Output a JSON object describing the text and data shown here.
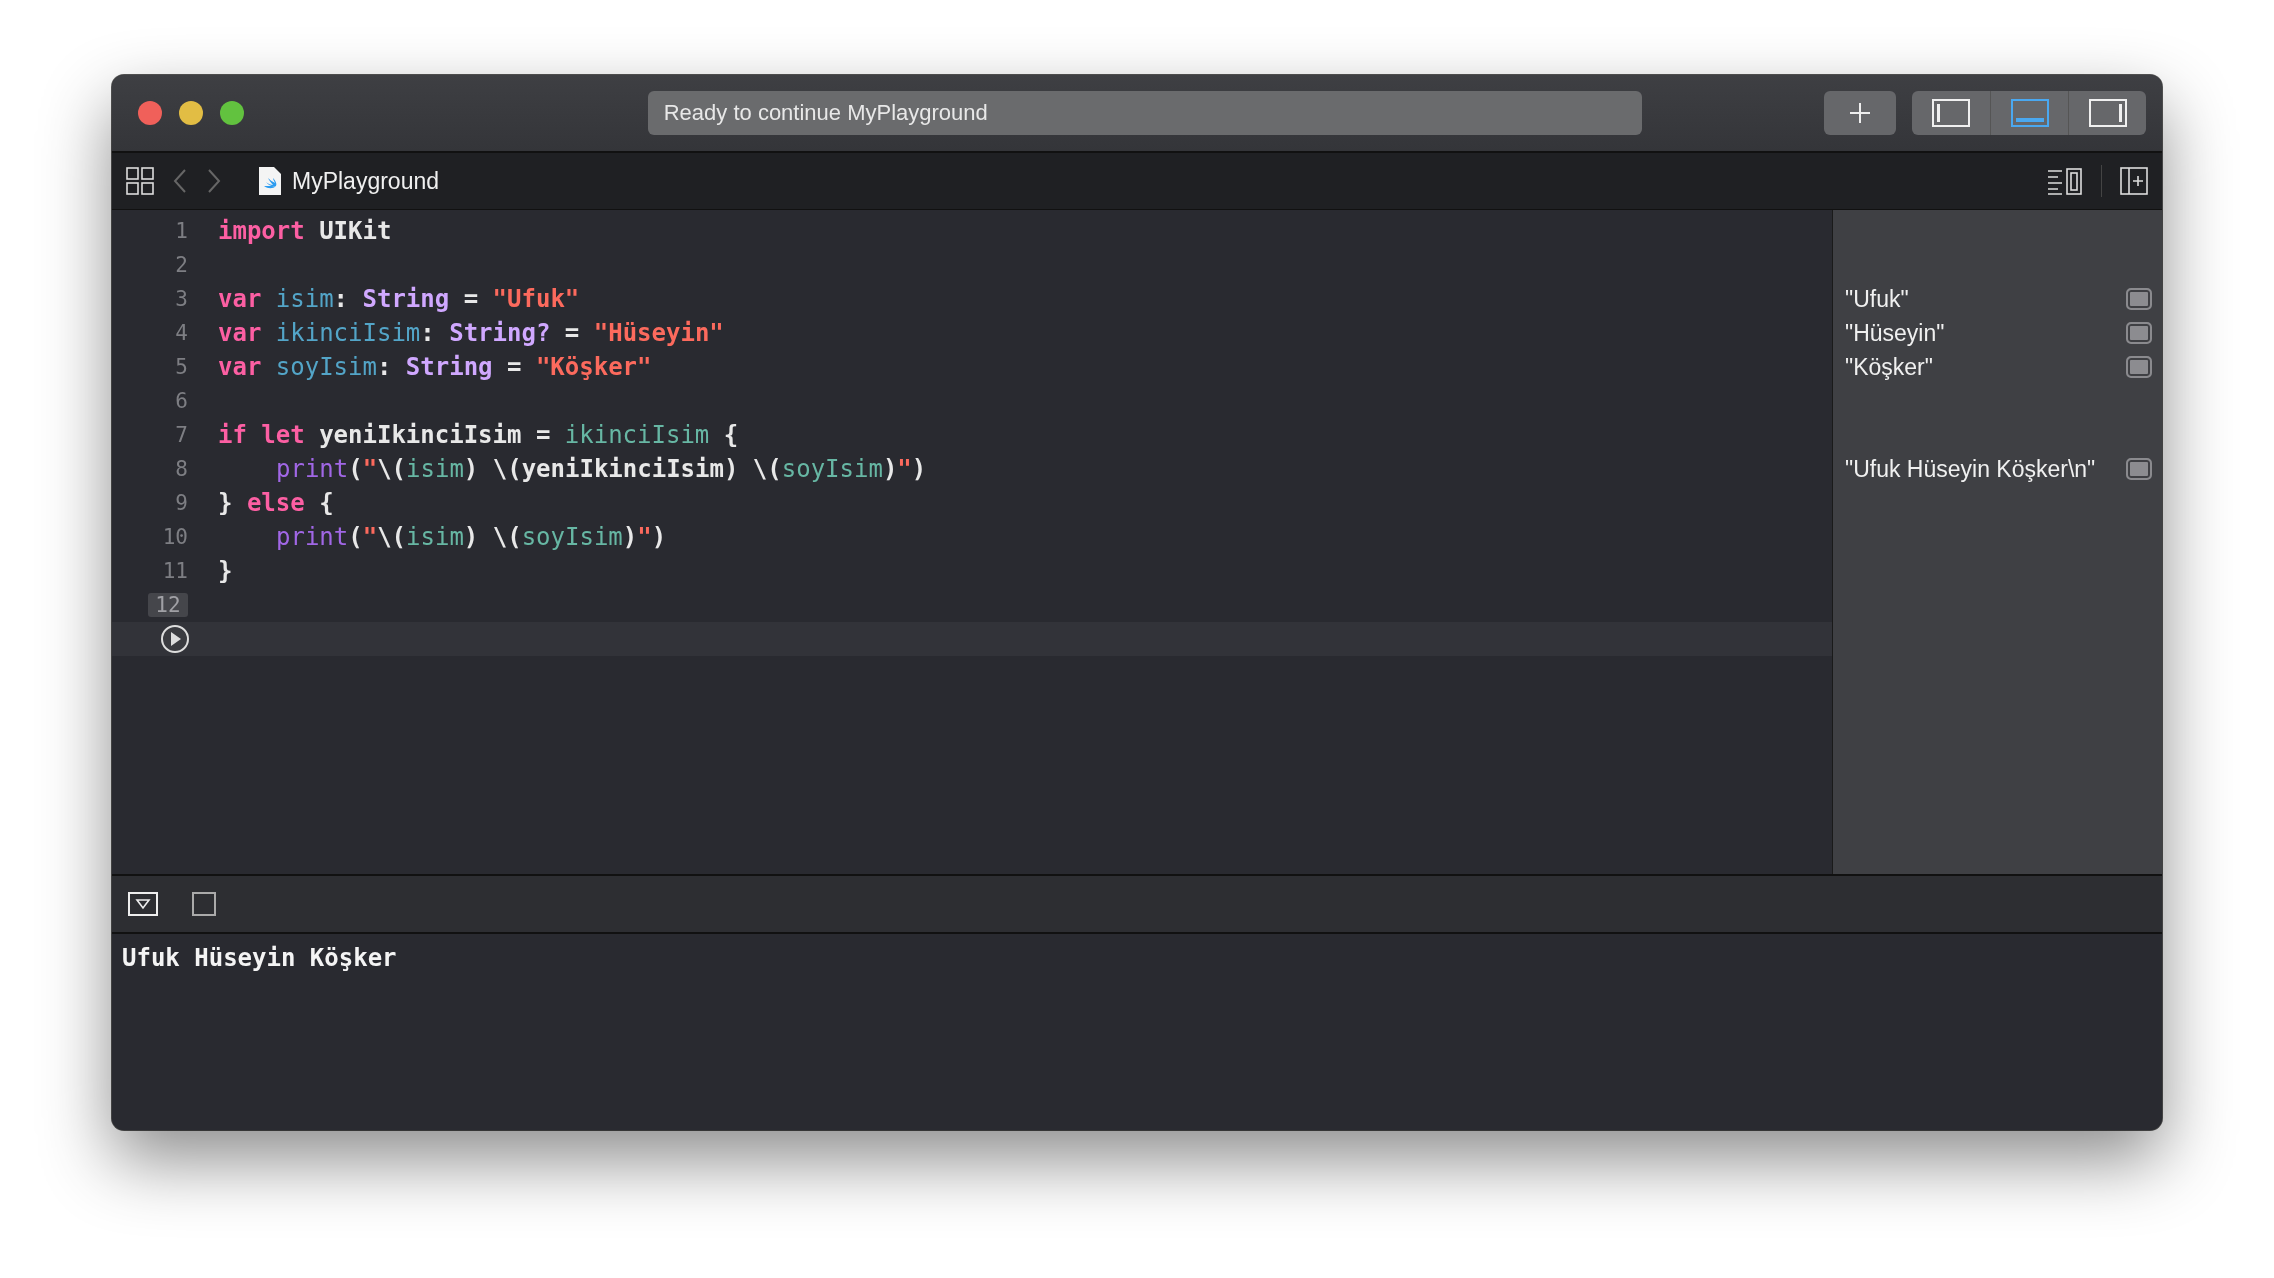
{
  "window": {
    "title": "Ready to continue MyPlayground",
    "layout_toggles": [
      {
        "kind": "left",
        "selected": false
      },
      {
        "kind": "bottom",
        "selected": true
      },
      {
        "kind": "right",
        "selected": false
      }
    ]
  },
  "jump_bar": {
    "file": "MyPlayground"
  },
  "editor": {
    "lines": [
      {
        "number": "1",
        "current": false,
        "tokens": [
          {
            "kind": "keyword",
            "text": "import"
          },
          {
            "kind": "plain",
            "text": " UIKit"
          }
        ]
      },
      {
        "number": "2",
        "current": false
      },
      {
        "number": "3",
        "current": false,
        "result": "\"Ufuk\"",
        "tokens": [
          {
            "kind": "keyword",
            "text": "var"
          },
          {
            "kind": "decl",
            "text": " isim"
          },
          {
            "kind": "plain",
            "text": ": "
          },
          {
            "kind": "type",
            "text": "String"
          },
          {
            "kind": "plain",
            "text": " = "
          },
          {
            "kind": "string",
            "text": "\"Ufuk\""
          }
        ]
      },
      {
        "number": "4",
        "current": false,
        "result": "\"Hüseyin\"",
        "tokens": [
          {
            "kind": "keyword",
            "text": "var"
          },
          {
            "kind": "decl",
            "text": " ikinciIsim"
          },
          {
            "kind": "plain",
            "text": ": "
          },
          {
            "kind": "type",
            "text": "String?"
          },
          {
            "kind": "plain",
            "text": " = "
          },
          {
            "kind": "string",
            "text": "\"Hüseyin\""
          }
        ]
      },
      {
        "number": "5",
        "current": false,
        "result": "\"Köşker\"",
        "tokens": [
          {
            "kind": "keyword",
            "text": "var"
          },
          {
            "kind": "decl",
            "text": " soyIsim"
          },
          {
            "kind": "plain",
            "text": ": "
          },
          {
            "kind": "type",
            "text": "String"
          },
          {
            "kind": "plain",
            "text": " = "
          },
          {
            "kind": "string",
            "text": "\"Köşker\""
          }
        ]
      },
      {
        "number": "6",
        "current": false
      },
      {
        "number": "7",
        "current": false,
        "tokens": [
          {
            "kind": "keyword",
            "text": "if let"
          },
          {
            "kind": "plain",
            "text": " yeniIkinciIsim = "
          },
          {
            "kind": "ref",
            "text": "ikinciIsim"
          },
          {
            "kind": "plain",
            "text": " {"
          }
        ],
        "children": [
          {
            "number": "8",
            "current": false,
            "result": "\"Ufuk Hüseyin Köşker\\n\"",
            "tokens": [
              {
                "kind": "func",
                "text": "print"
              },
              {
                "kind": "plain",
                "text": "("
              },
              {
                "kind": "string",
                "text": "\""
              },
              {
                "kind": "plain",
                "text": "\\("
              },
              {
                "kind": "ref",
                "text": "isim"
              },
              {
                "kind": "plain",
                "text": ") \\(yeniIkinciIsim) \\("
              },
              {
                "kind": "ref",
                "text": "soyIsim"
              },
              {
                "kind": "plain",
                "text": ")"
              },
              {
                "kind": "string",
                "text": "\""
              },
              {
                "kind": "plain",
                "text": ")"
              }
            ]
          }
        ]
      },
      {
        "number": "9",
        "current": false,
        "tokens": [
          {
            "kind": "plain",
            "text": "} "
          },
          {
            "kind": "keyword",
            "text": "else"
          },
          {
            "kind": "plain",
            "text": " {"
          }
        ],
        "children": [
          {
            "number": "10",
            "current": false,
            "tokens": [
              {
                "kind": "func",
                "text": "print"
              },
              {
                "kind": "plain",
                "text": "("
              },
              {
                "kind": "string",
                "text": "\""
              },
              {
                "kind": "plain",
                "text": "\\("
              },
              {
                "kind": "ref",
                "text": "isim"
              },
              {
                "kind": "plain",
                "text": ") \\("
              },
              {
                "kind": "ref",
                "text": "soyIsim"
              },
              {
                "kind": "plain",
                "text": ")"
              },
              {
                "kind": "string",
                "text": "\""
              },
              {
                "kind": "plain",
                "text": ")"
              }
            ]
          }
        ]
      },
      {
        "number": "11",
        "current": false,
        "tokens": [
          {
            "kind": "plain",
            "text": "}"
          }
        ]
      },
      {
        "number": "12",
        "current": true
      }
    ]
  },
  "console": {
    "output": "Ufuk Hüseyin Köşker"
  }
}
